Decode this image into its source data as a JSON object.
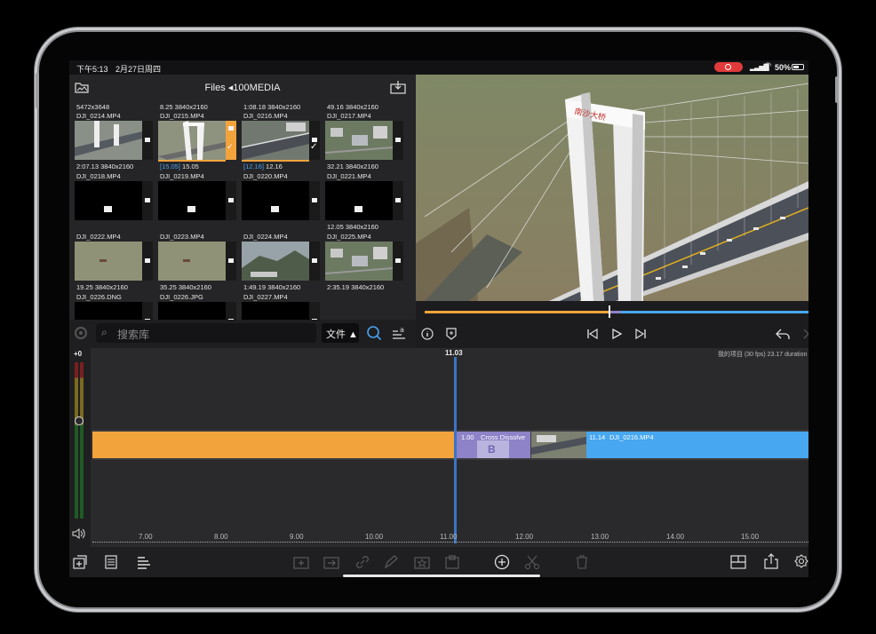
{
  "status": {
    "time": "下午5:13",
    "date": "2月27日周四",
    "battery": "50%"
  },
  "browser": {
    "title": "Files ◂100MEDIA",
    "search_placeholder": "搜索库",
    "sort_label": "文件 ▲",
    "top_metas": [
      "5472x3648",
      "8.25  3840x2160",
      "1:08.18  3840x2160",
      "49.16  3840x2160"
    ],
    "rows": [
      [
        {
          "name": "DJI_0214.MP4",
          "meta": "2:07.13  3840x2160",
          "thumb": "bridge"
        },
        {
          "name": "DJI_0215.MP4",
          "meta_in": "[15.05]",
          "meta": "15.05",
          "thumb": "tower",
          "selected": true
        },
        {
          "name": "DJI_0216.MP4",
          "meta_in": "[12.16]",
          "meta": "12.16",
          "thumb": "deck",
          "checked": true
        },
        {
          "name": "DJI_0217.MP4",
          "meta": "32.21  3840x2160",
          "thumb": "city"
        }
      ],
      [
        {
          "name": "DJI_0218.MP4",
          "meta": "",
          "thumb": "black"
        },
        {
          "name": "DJI_0219.MP4",
          "meta": "",
          "thumb": "black"
        },
        {
          "name": "DJI_0220.MP4",
          "meta": "",
          "thumb": "black"
        },
        {
          "name": "DJI_0221.MP4",
          "meta": "12.05  3840x2160",
          "thumb": "black"
        }
      ],
      [
        {
          "name": "DJI_0222.MP4",
          "meta": "19.25  3840x2160",
          "thumb": "water"
        },
        {
          "name": "DJI_0223.MP4",
          "meta": "35.25  3840x2160",
          "thumb": "water"
        },
        {
          "name": "DJI_0224.MP4",
          "meta": "1:49.19  3840x2160",
          "thumb": "hill"
        },
        {
          "name": "DJI_0225.MP4",
          "meta": "2:35.19  3840x2160",
          "thumb": "city"
        }
      ],
      [
        {
          "name": "DJI_0226.DNG",
          "meta": "",
          "thumb": "black"
        },
        {
          "name": "DJI_0226.JPG",
          "meta": "",
          "thumb": "black"
        },
        {
          "name": "DJI_0227.MP4",
          "meta": "",
          "thumb": "black"
        }
      ]
    ]
  },
  "viewer": {
    "bridge_sign": "南沙大桥",
    "playhead_fraction": 0.48
  },
  "timeline": {
    "level_label": "+0",
    "playhead_time": "11.03",
    "project_info": "我的项目 (30 fps)  23.17 duration",
    "ticks": [
      "7.00",
      "8.00",
      "9.00",
      "10.00",
      "11.00",
      "12.00",
      "13.00",
      "14.00",
      "15.00"
    ],
    "transition_duration": "1.00",
    "transition_name": "Cross Dissolve",
    "clip2_duration": "11.14",
    "clip2_name": "DJI_0216.MP4"
  },
  "colors": {
    "clip1": "#f2a33c",
    "clip2": "#47a7f0",
    "transition": "#8e82c8",
    "playhead": "#3b74c4"
  }
}
